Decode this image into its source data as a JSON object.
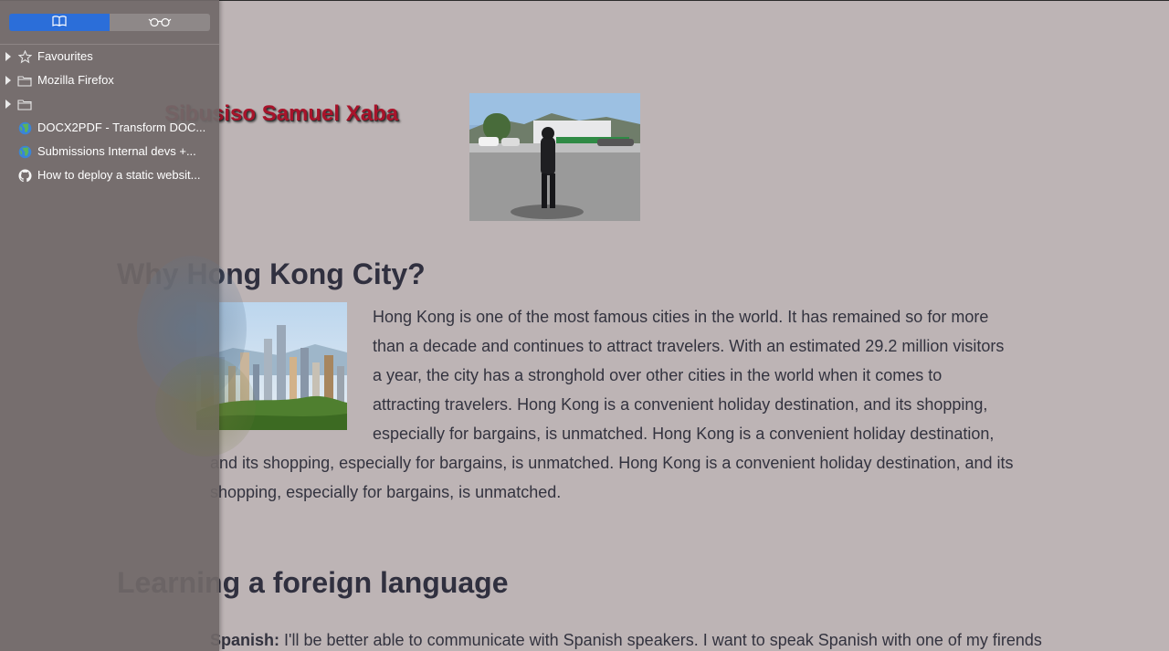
{
  "sidebar": {
    "tabs": [
      {
        "icon": "book-icon"
      },
      {
        "icon": "glasses-icon"
      }
    ],
    "items": [
      {
        "label": "Favourites",
        "icon": "star-icon",
        "expandable": true
      },
      {
        "label": "Mozilla Firefox",
        "icon": "folder-icon",
        "expandable": true
      },
      {
        "label": "",
        "icon": "folder-icon",
        "expandable": true
      },
      {
        "label": "DOCX2PDF - Transform DOC...",
        "icon": "globe-icon",
        "expandable": false
      },
      {
        "label": "Submissions Internal devs +...",
        "icon": "globe-icon",
        "expandable": false
      },
      {
        "label": "How to deploy a static websit...",
        "icon": "github-icon",
        "expandable": false
      }
    ]
  },
  "main": {
    "heading": "Sibusiso Samuel Xaba",
    "section1_title": "Why Hong Kong City?",
    "section1_text_a": "Hong Kong is one of the most famous cities in the world. It has remained so for more than a decade and continues to attract travelers. With an estimated 29.2 million visitors a year, the city has a stronghold over other cities in the world when it comes to attracting travelers. Hong Kong is a convenient holiday destination, and its shopping, especially for bargains, is unmatched. Hong Kong is a convenient holiday destination,",
    "section1_text_b": "and its shopping, especially for bargains, is unmatched. Hong Kong is a convenient holiday destination, and its shopping, especially for bargains, is unmatched.",
    "section2_title": "Learning a foreign language",
    "section2_label": "Spanish:",
    "section2_text": "I'll be better able to communicate with Spanish speakers. I want to speak Spanish with one of my firends"
  },
  "colors": {
    "accent": "#2b6ed9",
    "heading": "#a8132a",
    "background": "#bdb4b5"
  }
}
